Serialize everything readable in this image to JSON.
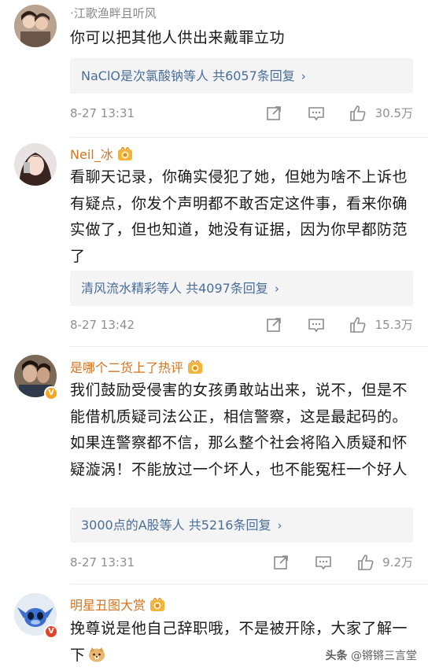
{
  "comments": [
    {
      "username": "·江歌渔畔且听风",
      "text": "你可以把其他人供出来戴罪立功",
      "reply_summary": "NaClO是次氯酸钠等人  共6057条回复",
      "time": "8-27 13:31",
      "likes": "30.5万"
    },
    {
      "username": "Neil_冰",
      "text": "看聊天记录，你确实侵犯了她，但她为啥不上诉也有疑点，你发个声明都不敢否定这件事，看来你确实做了，但也知道，她没有证据，因为你早都防范了",
      "reply_summary": "清风流水精彩等人  共4097条回复",
      "time": "8-27 13:42",
      "likes": "15.3万"
    },
    {
      "username": "是哪个二货上了热评",
      "text": "我们鼓励受侵害的女孩勇敢站出来，说不，但是不能借机质疑司法公正，相信警察，这是最起码的。如果连警察都不信，那么整个社会将陷入质疑和怀疑漩涡！不能放过一个坏人，也不能冤枉一个好人",
      "reply_summary": "3000点的A股等人  共5216条回复",
      "time": "8-27 13:31",
      "likes": "9.2万"
    },
    {
      "username": "明星丑图大赏",
      "text": "挽尊说是他自己辞职哦，不是被开除，大家了解一下",
      "reply_summary": "",
      "time": "",
      "likes": ""
    }
  ],
  "reply_chevron": "›",
  "watermark": {
    "vendor": "头条",
    "account": "@锵锵三言堂"
  },
  "colors": {
    "username": "#d6731e",
    "link": "#4a6e98",
    "meta": "#8f8f8f",
    "reply_bg": "#f4f4f4"
  },
  "icons": [
    "share-icon",
    "comment-icon",
    "like-icon",
    "medal-icon",
    "verified-badge-icon"
  ]
}
